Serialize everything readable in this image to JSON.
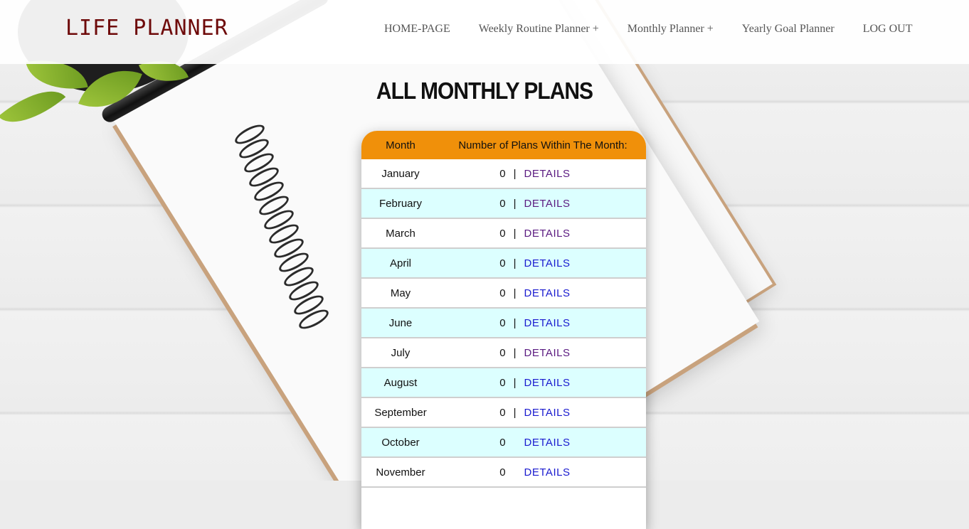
{
  "header": {
    "logo": "LIFE PLANNER",
    "nav": [
      {
        "label": "HOME-PAGE"
      },
      {
        "label": "Weekly Routine Planner +"
      },
      {
        "label": "Monthly Planner +"
      },
      {
        "label": "Yearly Goal Planner"
      },
      {
        "label": "LOG OUT"
      }
    ]
  },
  "page": {
    "title": "ALL MONTHLY PLANS"
  },
  "table": {
    "headers": {
      "month": "Month",
      "count": "Number of Plans Within The Month:"
    },
    "link_label": "DETAILS",
    "separator": "|",
    "rows": [
      {
        "month": "January",
        "count": "0",
        "sep": "|",
        "link": "DETAILS"
      },
      {
        "month": "February",
        "count": "0",
        "sep": "|",
        "link": "DETAILS"
      },
      {
        "month": "March",
        "count": "0",
        "sep": "|",
        "link": "DETAILS"
      },
      {
        "month": "April",
        "count": "0",
        "sep": "|",
        "link": "DETAILS"
      },
      {
        "month": "May",
        "count": "0",
        "sep": "|",
        "link": "DETAILS"
      },
      {
        "month": "June",
        "count": "0",
        "sep": "|",
        "link": "DETAILS"
      },
      {
        "month": "July",
        "count": "0",
        "sep": "|",
        "link": "DETAILS"
      },
      {
        "month": "August",
        "count": "0",
        "sep": "|",
        "link": "DETAILS"
      },
      {
        "month": "September",
        "count": "0",
        "sep": "|",
        "link": "DETAILS"
      },
      {
        "month": "October",
        "count": "0",
        "sep": "",
        "link": "DETAILS"
      },
      {
        "month": "November",
        "count": "0",
        "sep": "",
        "link": "DETAILS"
      }
    ]
  },
  "colors": {
    "header_bg": "#f0900a",
    "row_alt": "#dcffff",
    "link": "#1a1acf",
    "link_visited": "#5a1a80",
    "logo": "#6e0a0a"
  }
}
